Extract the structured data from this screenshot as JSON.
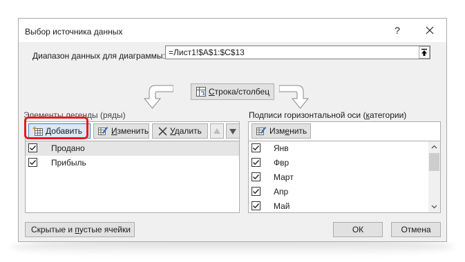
{
  "dialog": {
    "title": "Выбор источника данных",
    "help": "?",
    "close_icon": "close-icon"
  },
  "range": {
    "label_prefix": "Д",
    "label_rest": "иапазон данных для диаграммы:",
    "value": "=Лист1!$A$1:$C$13",
    "collapse_icon": "collapse-dialog-icon"
  },
  "switch": {
    "label_prefix": "С",
    "label_rest": "трока/столбец",
    "icon": "switch-row-column-icon"
  },
  "legend": {
    "label": "Элементы легенды (ряды)",
    "toolbar": {
      "add_prefix": "Д",
      "add_rest": "обавить",
      "edit_prefix": "И",
      "edit_rest": "зменить",
      "delete_prefix": "У",
      "delete_rest": "далить"
    },
    "items": [
      {
        "label": "Продано",
        "checked": true,
        "selected": true
      },
      {
        "label": "Прибыль",
        "checked": true,
        "selected": false
      }
    ]
  },
  "axis": {
    "label_start": "Подписи горизонтальной оси (",
    "label_u": "к",
    "label_end": "атегории)",
    "edit_start": "Изм",
    "edit_u": "е",
    "edit_end": "нить",
    "items": [
      {
        "label": "Янв",
        "checked": true
      },
      {
        "label": "Фвр",
        "checked": true
      },
      {
        "label": "Март",
        "checked": true
      },
      {
        "label": "Апр",
        "checked": true
      },
      {
        "label": "Май",
        "checked": true
      }
    ]
  },
  "footer": {
    "hidden_prefix": "Скрытые и ",
    "hidden_u": "п",
    "hidden_rest": "устые ячейки",
    "ok": "ОК",
    "cancel": "Отмена"
  },
  "colors": {
    "highlight": "#e8191b",
    "accent_border": "#3c7fb1"
  }
}
